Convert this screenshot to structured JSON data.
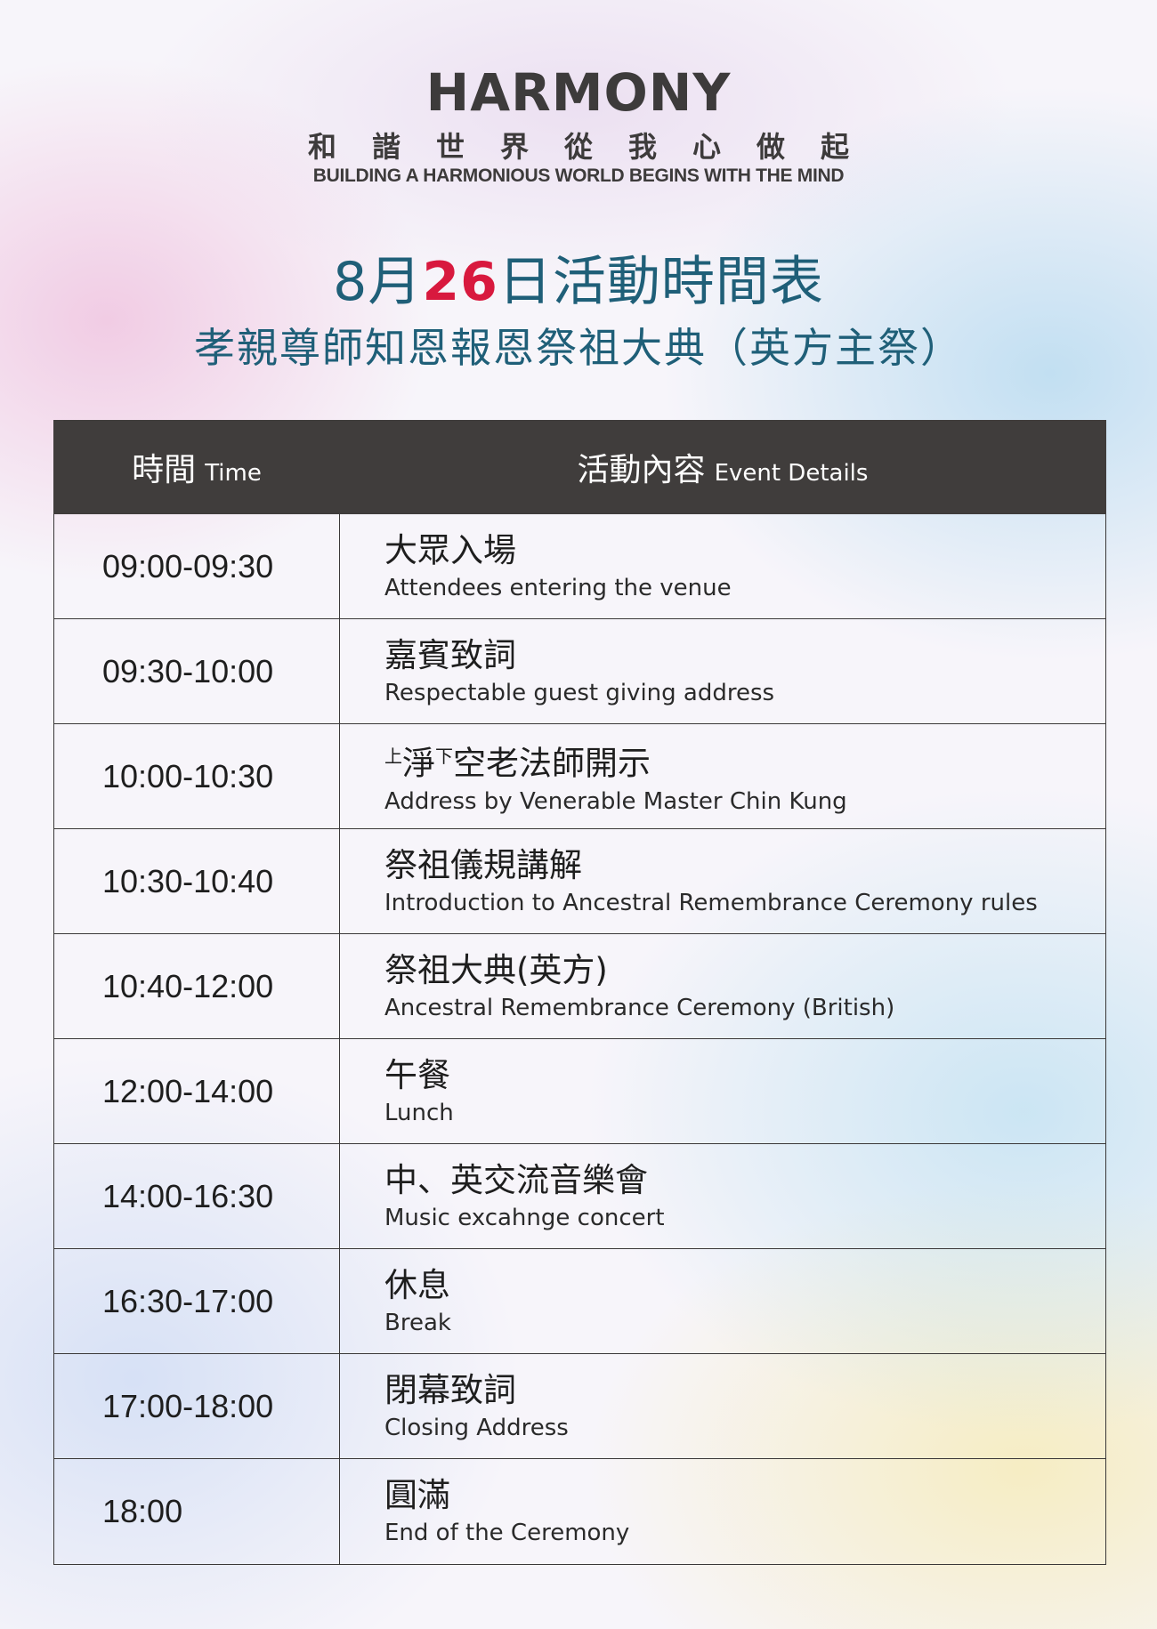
{
  "header": {
    "brand": "HARMONY",
    "motto_zh": "和諧世界從我心做起",
    "motto_en": "BUILDING A HARMONIOUS WORLD BEGINS WITH THE MIND"
  },
  "title": {
    "prefix": "8月",
    "day": "26",
    "suffix": "日活動時間表",
    "subtitle": "孝親尊師知恩報恩祭祖大典（英方主祭）"
  },
  "table": {
    "headers": {
      "time_zh": "時間",
      "time_en": "Time",
      "event_zh": "活動內容",
      "event_en": "Event Details"
    },
    "rows": [
      {
        "time": "09:00-09:30",
        "zh": "大眾入場",
        "en": "Attendees entering the venue"
      },
      {
        "time": "09:30-10:00",
        "zh": "嘉賓致詞",
        "en": "Respectable guest giving address"
      },
      {
        "time": "10:00-10:30",
        "zh_pre": "上",
        "zh_a": "淨",
        "zh_mid": "下",
        "zh_b": "空老法師開示",
        "en": "Address by Venerable Master Chin Kung"
      },
      {
        "time": "10:30-10:40",
        "zh": "祭祖儀規講解",
        "en": "Introduction to Ancestral Remembrance Ceremony rules"
      },
      {
        "time": "10:40-12:00",
        "zh": "祭祖大典(英方)",
        "en": "Ancestral Remembrance Ceremony (British)"
      },
      {
        "time": "12:00-14:00",
        "zh": "午餐",
        "en": "Lunch"
      },
      {
        "time": "14:00-16:30",
        "zh": "中、英交流音樂會",
        "en": "Music excahnge concert"
      },
      {
        "time": "16:30-17:00",
        "zh": "休息",
        "en": "Break"
      },
      {
        "time": "17:00-18:00",
        "zh": "閉幕致詞",
        "en": "Closing Address"
      },
      {
        "time": "18:00",
        "zh": "圓滿",
        "en": "End of the Ceremony"
      }
    ]
  }
}
